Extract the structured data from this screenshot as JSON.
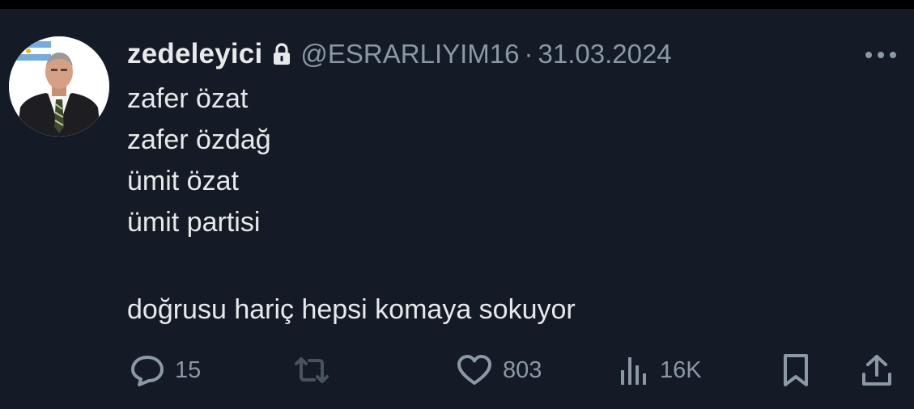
{
  "tweet": {
    "display_name": "zedeleyici",
    "handle": "@ESRARLIYIM16",
    "separator": "·",
    "date": "31.03.2024",
    "lines": [
      "zafer özat",
      "zafer özdağ",
      "ümit özat",
      "ümit partisi"
    ],
    "final_line": "doğrusu hariç hepsi komaya sokuyor"
  },
  "actions": {
    "replies": "15",
    "retweets": "",
    "likes": "803",
    "views": "16K"
  },
  "icons": {
    "lock": "lock-icon",
    "more": "more-icon",
    "reply": "reply-icon",
    "retweet": "retweet-icon",
    "like": "heart-icon",
    "views": "views-icon",
    "bookmark": "bookmark-icon",
    "share": "share-icon"
  },
  "colors": {
    "background": "#141b26",
    "primary_text": "#e7e9ea",
    "secondary_text": "#8b98a5"
  }
}
